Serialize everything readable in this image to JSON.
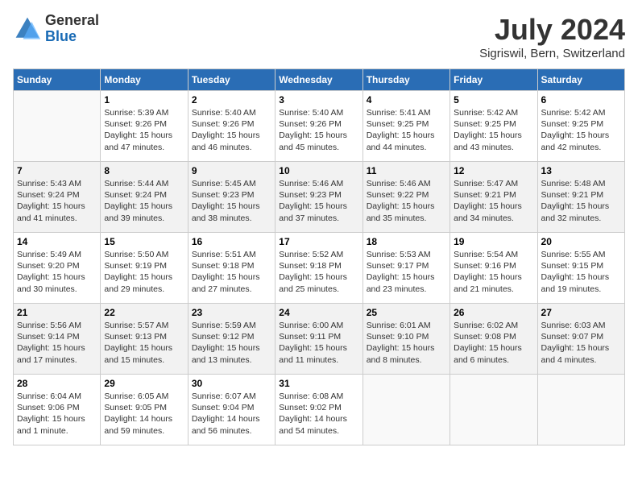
{
  "header": {
    "logo": {
      "general": "General",
      "blue": "Blue"
    },
    "title": "July 2024",
    "location": "Sigriswil, Bern, Switzerland"
  },
  "weekdays": [
    "Sunday",
    "Monday",
    "Tuesday",
    "Wednesday",
    "Thursday",
    "Friday",
    "Saturday"
  ],
  "weeks": [
    [
      {
        "day": null
      },
      {
        "day": 1,
        "sunrise": "5:39 AM",
        "sunset": "9:26 PM",
        "daylight": "15 hours and 47 minutes."
      },
      {
        "day": 2,
        "sunrise": "5:40 AM",
        "sunset": "9:26 PM",
        "daylight": "15 hours and 46 minutes."
      },
      {
        "day": 3,
        "sunrise": "5:40 AM",
        "sunset": "9:26 PM",
        "daylight": "15 hours and 45 minutes."
      },
      {
        "day": 4,
        "sunrise": "5:41 AM",
        "sunset": "9:25 PM",
        "daylight": "15 hours and 44 minutes."
      },
      {
        "day": 5,
        "sunrise": "5:42 AM",
        "sunset": "9:25 PM",
        "daylight": "15 hours and 43 minutes."
      },
      {
        "day": 6,
        "sunrise": "5:42 AM",
        "sunset": "9:25 PM",
        "daylight": "15 hours and 42 minutes."
      }
    ],
    [
      {
        "day": 7,
        "sunrise": "5:43 AM",
        "sunset": "9:24 PM",
        "daylight": "15 hours and 41 minutes."
      },
      {
        "day": 8,
        "sunrise": "5:44 AM",
        "sunset": "9:24 PM",
        "daylight": "15 hours and 39 minutes."
      },
      {
        "day": 9,
        "sunrise": "5:45 AM",
        "sunset": "9:23 PM",
        "daylight": "15 hours and 38 minutes."
      },
      {
        "day": 10,
        "sunrise": "5:46 AM",
        "sunset": "9:23 PM",
        "daylight": "15 hours and 37 minutes."
      },
      {
        "day": 11,
        "sunrise": "5:46 AM",
        "sunset": "9:22 PM",
        "daylight": "15 hours and 35 minutes."
      },
      {
        "day": 12,
        "sunrise": "5:47 AM",
        "sunset": "9:21 PM",
        "daylight": "15 hours and 34 minutes."
      },
      {
        "day": 13,
        "sunrise": "5:48 AM",
        "sunset": "9:21 PM",
        "daylight": "15 hours and 32 minutes."
      }
    ],
    [
      {
        "day": 14,
        "sunrise": "5:49 AM",
        "sunset": "9:20 PM",
        "daylight": "15 hours and 30 minutes."
      },
      {
        "day": 15,
        "sunrise": "5:50 AM",
        "sunset": "9:19 PM",
        "daylight": "15 hours and 29 minutes."
      },
      {
        "day": 16,
        "sunrise": "5:51 AM",
        "sunset": "9:18 PM",
        "daylight": "15 hours and 27 minutes."
      },
      {
        "day": 17,
        "sunrise": "5:52 AM",
        "sunset": "9:18 PM",
        "daylight": "15 hours and 25 minutes."
      },
      {
        "day": 18,
        "sunrise": "5:53 AM",
        "sunset": "9:17 PM",
        "daylight": "15 hours and 23 minutes."
      },
      {
        "day": 19,
        "sunrise": "5:54 AM",
        "sunset": "9:16 PM",
        "daylight": "15 hours and 21 minutes."
      },
      {
        "day": 20,
        "sunrise": "5:55 AM",
        "sunset": "9:15 PM",
        "daylight": "15 hours and 19 minutes."
      }
    ],
    [
      {
        "day": 21,
        "sunrise": "5:56 AM",
        "sunset": "9:14 PM",
        "daylight": "15 hours and 17 minutes."
      },
      {
        "day": 22,
        "sunrise": "5:57 AM",
        "sunset": "9:13 PM",
        "daylight": "15 hours and 15 minutes."
      },
      {
        "day": 23,
        "sunrise": "5:59 AM",
        "sunset": "9:12 PM",
        "daylight": "15 hours and 13 minutes."
      },
      {
        "day": 24,
        "sunrise": "6:00 AM",
        "sunset": "9:11 PM",
        "daylight": "15 hours and 11 minutes."
      },
      {
        "day": 25,
        "sunrise": "6:01 AM",
        "sunset": "9:10 PM",
        "daylight": "15 hours and 8 minutes."
      },
      {
        "day": 26,
        "sunrise": "6:02 AM",
        "sunset": "9:08 PM",
        "daylight": "15 hours and 6 minutes."
      },
      {
        "day": 27,
        "sunrise": "6:03 AM",
        "sunset": "9:07 PM",
        "daylight": "15 hours and 4 minutes."
      }
    ],
    [
      {
        "day": 28,
        "sunrise": "6:04 AM",
        "sunset": "9:06 PM",
        "daylight": "15 hours and 1 minute."
      },
      {
        "day": 29,
        "sunrise": "6:05 AM",
        "sunset": "9:05 PM",
        "daylight": "14 hours and 59 minutes."
      },
      {
        "day": 30,
        "sunrise": "6:07 AM",
        "sunset": "9:04 PM",
        "daylight": "14 hours and 56 minutes."
      },
      {
        "day": 31,
        "sunrise": "6:08 AM",
        "sunset": "9:02 PM",
        "daylight": "14 hours and 54 minutes."
      },
      {
        "day": null
      },
      {
        "day": null
      },
      {
        "day": null
      }
    ]
  ]
}
